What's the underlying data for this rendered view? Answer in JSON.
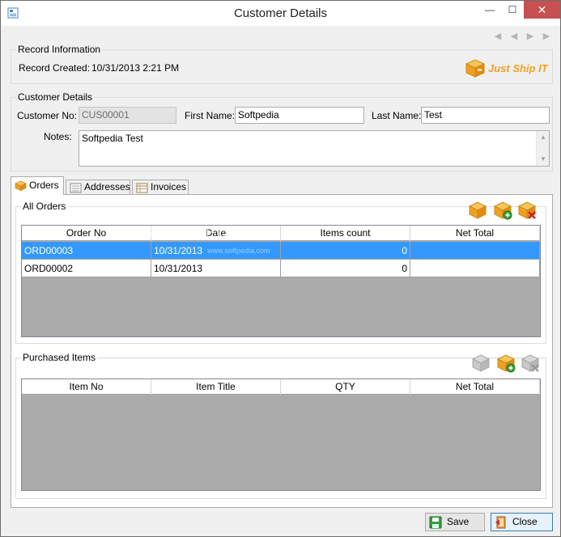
{
  "window": {
    "title": "Customer Details",
    "minimize_glyph": "—",
    "maximize_glyph": "☐",
    "close_glyph": "✕"
  },
  "nav": {
    "first_glyph": "◀",
    "prev_glyph": "◀",
    "next_glyph": "▶",
    "last_glyph": "▶"
  },
  "record_info": {
    "group_label": "Record Information",
    "created_label": "Record Created:",
    "created_value": "10/31/2013 2:21 PM",
    "logo_text": "Just Ship IT"
  },
  "customer": {
    "group_label": "Customer Details",
    "customer_no_label": "Customer No:",
    "customer_no_value": "CUS00001",
    "first_name_label": "First Name:",
    "first_name_value": "Softpedia",
    "last_name_label": "Last Name:",
    "last_name_value": "Test",
    "notes_label": "Notes:",
    "notes_value": "Softpedia Test"
  },
  "tabs": [
    {
      "label": "Orders",
      "icon": "box-icon",
      "active": true
    },
    {
      "label": "Addresses",
      "icon": "address-card-icon",
      "active": false
    },
    {
      "label": "Invoices",
      "icon": "invoice-table-icon",
      "active": false
    }
  ],
  "orders": {
    "group_label": "All Orders",
    "columns": [
      "Order No",
      "Date",
      "Items count",
      "Net Total"
    ],
    "rows": [
      {
        "order_no": "ORD00003",
        "date": "10/31/2013",
        "items_count": "0",
        "net_total": "",
        "selected": true
      },
      {
        "order_no": "ORD00002",
        "date": "10/31/2013",
        "items_count": "0",
        "net_total": "",
        "selected": false
      }
    ]
  },
  "purchased": {
    "group_label": "Purchased Items",
    "columns": [
      "Item No",
      "Item Title",
      "QTY",
      "Net Total"
    ]
  },
  "watermark": {
    "main": "SOFTPEDIA",
    "sub": "www.softpedia.com"
  },
  "buttons": {
    "save": "Save",
    "close": "Close"
  },
  "colors": {
    "selection": "#3399ff",
    "close_button": "#c75050",
    "grid_empty": "#ababab",
    "logo": "#f0a020"
  }
}
